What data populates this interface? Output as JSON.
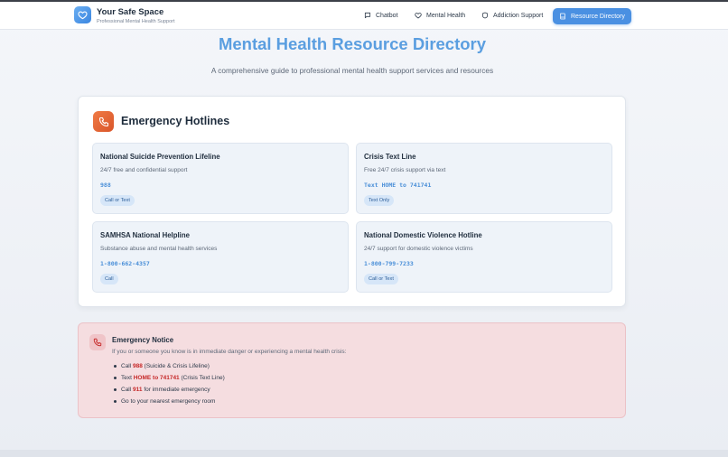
{
  "brand": {
    "name": "Your Safe Space",
    "tagline": "Professional Mental Health Support"
  },
  "nav": {
    "chatbot": "Chatbot",
    "mental_health": "Mental Health",
    "addiction_support": "Addiction Support",
    "resource_directory": "Resource Directory"
  },
  "page": {
    "title": "Mental Health Resource Directory",
    "subtitle": "A comprehensive guide to professional mental health support services and resources"
  },
  "hotlines": {
    "title": "Emergency Hotlines",
    "cards": [
      {
        "name": "National Suicide Prevention Lifeline",
        "desc": "24/7 free and confidential support",
        "number": "988",
        "badge": "Call or Text"
      },
      {
        "name": "Crisis Text Line",
        "desc": "Free 24/7 crisis support via text",
        "number": "Text HOME to 741741",
        "badge": "Text Only"
      },
      {
        "name": "SAMHSA National Helpline",
        "desc": "Substance abuse and mental health services",
        "number": "1-800-662-4357",
        "badge": "Call"
      },
      {
        "name": "National Domestic Violence Hotline",
        "desc": "24/7 support for domestic violence victims",
        "number": "1-800-799-7233",
        "badge": "Call or Text"
      }
    ]
  },
  "notice": {
    "title": "Emergency Notice",
    "intro": "If you or someone you know is in immediate danger or experiencing a mental health crisis:",
    "items": [
      {
        "pre": "Call ",
        "highlight": "988",
        "post": " (Suicide & Crisis Lifeline)"
      },
      {
        "pre": "Text ",
        "highlight": "HOME to 741741",
        "post": " (Crisis Text Line)"
      },
      {
        "pre": "Call ",
        "highlight": "911",
        "post": " for immediate emergency"
      },
      {
        "pre": "Go to your nearest emergency room",
        "highlight": "",
        "post": ""
      }
    ]
  },
  "colors": {
    "accent": "#4a90e2",
    "title": "#5a9ee0",
    "emergency": "#c62828",
    "hotline_icon": "#e2653a"
  },
  "icons": {
    "logo": "heart-icon",
    "chatbot": "chat-bubble-icon",
    "mental_health": "heart-icon",
    "addiction_support": "shield-icon",
    "resource_directory": "book-icon",
    "hotlines": "phone-icon",
    "notice": "phone-icon"
  }
}
